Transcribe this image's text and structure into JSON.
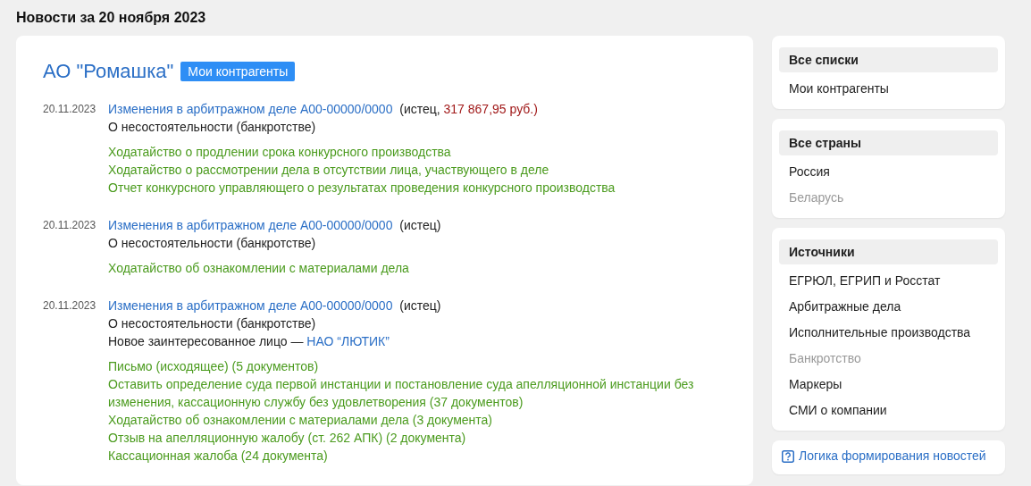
{
  "page_title": "Новости за 20 ноября 2023",
  "company": {
    "name": "АО \"Ромашка\"",
    "tag": "Мои контрагенты"
  },
  "events": [
    {
      "date": "20.11.2023",
      "case_link": "Изменения в арбитражном деле А00-00000/0000",
      "party": "(истец, ",
      "claim": "317 867,95 руб.)",
      "lines": [
        {
          "text": "О несостоятельности (банкротстве)"
        }
      ],
      "documents": [
        "Ходатайство о продлении срока конкурсного производства",
        "Ходатайство о рассмотрении дела в отсутствии лица, участвующего в деле",
        "Отчет конкурсного управляющего о результатах проведения конкурсного производства"
      ]
    },
    {
      "date": "20.11.2023",
      "case_link": "Изменения в арбитражном деле А00-00000/0000",
      "party": "(истец)",
      "lines": [
        {
          "text": "О несостоятельности (банкротстве)"
        }
      ],
      "documents": [
        "Ходатайство об ознакомлении с материалами дела"
      ]
    },
    {
      "date": "20.11.2023",
      "case_link": "Изменения в арбитражном деле А00-00000/0000",
      "party": "(истец)",
      "lines": [
        {
          "text": "О несостоятельности (банкротстве)"
        },
        {
          "text": "Новое заинтересованное лицо — ",
          "link": "НАО “ЛЮТИК”"
        }
      ],
      "documents": [
        "Письмо (исходящее) (5 документов)",
        "Оставить определение суда первой инстанции и постановление суда апелляционной инстанции без изменения, кассационную службу без удовлетворения (37 документов)",
        "Ходатайство об ознакомлении с материалами дела (3 документа)",
        "Отзыв на апелляционную жалобу (ст. 262 АПК) (2 документа)",
        "Кассационная жалоба (24 документа)"
      ]
    }
  ],
  "sidebar": [
    {
      "items": [
        {
          "kind": "header",
          "label": "Все списки"
        },
        {
          "kind": "item",
          "label": "Мои контрагенты",
          "disabled": false
        }
      ]
    },
    {
      "items": [
        {
          "kind": "header",
          "label": "Все страны"
        },
        {
          "kind": "item",
          "label": "Россия",
          "disabled": false
        },
        {
          "kind": "item",
          "label": "Беларусь",
          "disabled": true
        }
      ]
    },
    {
      "items": [
        {
          "kind": "header",
          "label": "Источники"
        },
        {
          "kind": "item",
          "label": "ЕГРЮЛ, ЕГРИП и Росстат",
          "disabled": false
        },
        {
          "kind": "item",
          "label": "Арбитражные дела",
          "disabled": false
        },
        {
          "kind": "item",
          "label": "Исполнительные производства",
          "disabled": false
        },
        {
          "kind": "item",
          "label": "Банкротство",
          "disabled": true
        },
        {
          "kind": "item",
          "label": "Маркеры",
          "disabled": false
        },
        {
          "kind": "item",
          "label": "СМИ о компании",
          "disabled": false
        }
      ]
    }
  ],
  "help_link": "Логика формирования новостей"
}
